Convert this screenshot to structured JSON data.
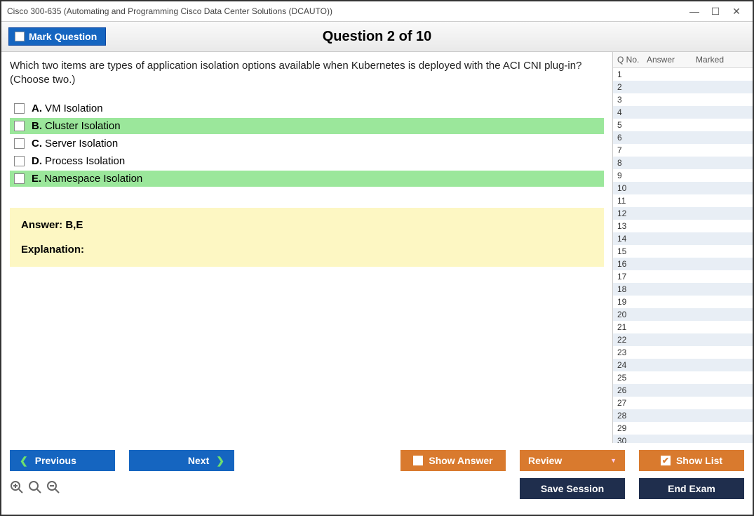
{
  "window": {
    "title": "Cisco 300-635 (Automating and Programming Cisco Data Center Solutions (DCAUTO))"
  },
  "header": {
    "mark_label": "Mark Question",
    "question_title": "Question 2 of 10"
  },
  "question": {
    "text": "Which two items are types of application isolation options available when Kubernetes is deployed with the ACI CNI plug-in? (Choose two.)",
    "choices": [
      {
        "letter": "A.",
        "text": "VM Isolation",
        "correct": false
      },
      {
        "letter": "B.",
        "text": "Cluster Isolation",
        "correct": true
      },
      {
        "letter": "C.",
        "text": "Server Isolation",
        "correct": false
      },
      {
        "letter": "D.",
        "text": "Process Isolation",
        "correct": false
      },
      {
        "letter": "E.",
        "text": "Namespace Isolation",
        "correct": true
      }
    ]
  },
  "answer": {
    "label": "Answer: B,E",
    "explanation_label": "Explanation:"
  },
  "side": {
    "headers": {
      "qno": "Q No.",
      "answer": "Answer",
      "marked": "Marked"
    },
    "count": 30
  },
  "footer": {
    "previous": "Previous",
    "next": "Next",
    "show_answer": "Show Answer",
    "review": "Review",
    "show_list": "Show List",
    "save_session": "Save Session",
    "end_exam": "End Exam"
  }
}
